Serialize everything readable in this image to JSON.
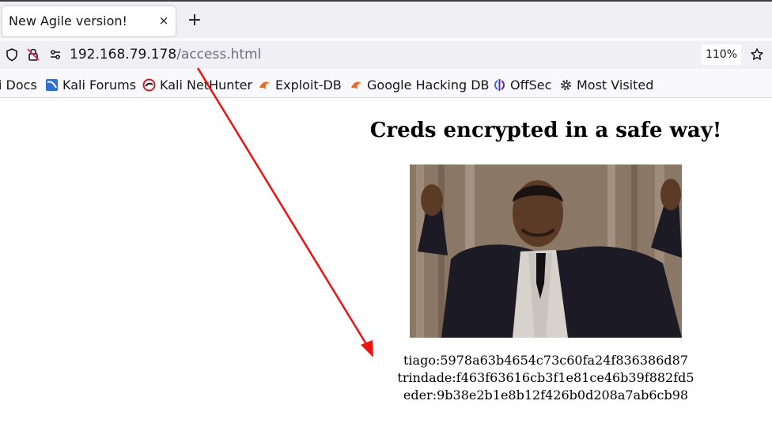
{
  "tab": {
    "title": "New Agile version!",
    "close": "×"
  },
  "new_tab": "+",
  "url": {
    "host": "192.168.79.178",
    "path": "/access.html"
  },
  "zoom": "110%",
  "bookmarks": [
    {
      "label": "i Docs",
      "icon": "kali-icon"
    },
    {
      "label": "Kali Forums",
      "icon": "kali-forums-icon"
    },
    {
      "label": "Kali NetHunter",
      "icon": "nethunter-icon"
    },
    {
      "label": "Exploit-DB",
      "icon": "exploit-db-icon"
    },
    {
      "label": "Google Hacking DB",
      "icon": "ghdb-icon"
    },
    {
      "label": "OffSec",
      "icon": "offsec-icon"
    },
    {
      "label": "Most Visited",
      "icon": "gear-icon"
    }
  ],
  "page": {
    "heading": "Creds encrypted in a safe way!",
    "creds": [
      "tiago:5978a63b4654c73c60fa24f836386d87",
      "trindade:f463f63616cb3f1e81ce46b39f882fd5",
      "eder:9b38e2b1e8b12f426b0d208a7ab6cb98"
    ]
  },
  "colors": {
    "annotation_arrow": "#ee1111",
    "chrome_bg": "#f0f0f4"
  }
}
